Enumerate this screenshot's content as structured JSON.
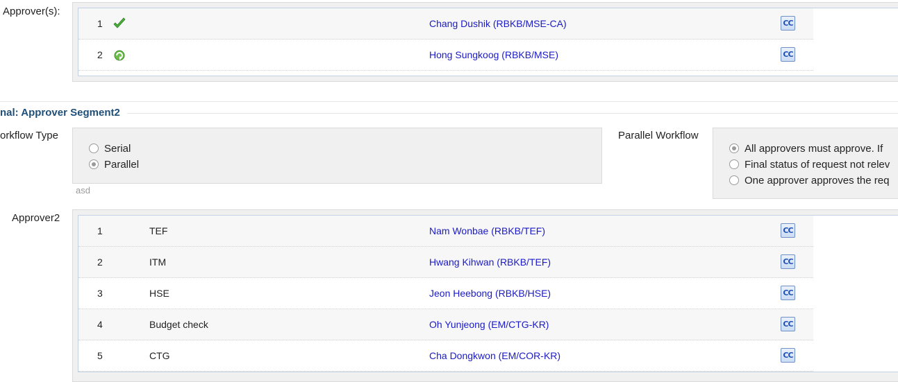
{
  "approvers_section": {
    "label": "Approver(s):",
    "rows": [
      {
        "num": "1",
        "status": "approved",
        "status_icon": "check-icon",
        "name": "Chang Dushik (RBKB/MSE-CA)",
        "cc": "CC"
      },
      {
        "num": "2",
        "status": "in-progress",
        "status_icon": "refresh-icon",
        "name": "Hong Sungkoog (RBKB/MSE)",
        "cc": "CC"
      }
    ]
  },
  "segment2": {
    "title": "nal: Approver Segment2",
    "workflow_type": {
      "label": "orkflow Type",
      "options": [
        {
          "label": "Serial",
          "checked": false
        },
        {
          "label": "Parallel",
          "checked": true
        }
      ],
      "hint": "asd"
    },
    "parallel_workflow": {
      "label": "Parallel Workflow",
      "options": [
        {
          "label": "All approvers must approve. If",
          "checked": true
        },
        {
          "label": "Final status of request not relev",
          "checked": false
        },
        {
          "label": "One approver approves the req",
          "checked": false
        }
      ]
    },
    "approver2": {
      "label": "Approver2",
      "rows": [
        {
          "num": "1",
          "desc": "TEF",
          "name": "Nam Wonbae (RBKB/TEF)",
          "cc": "CC"
        },
        {
          "num": "2",
          "desc": "ITM",
          "name": "Hwang Kihwan (RBKB/TEF)",
          "cc": "CC"
        },
        {
          "num": "3",
          "desc": "HSE",
          "name": "Jeon Heebong (RBKB/HSE)",
          "cc": "CC"
        },
        {
          "num": "4",
          "desc": "Budget check",
          "name": "Oh Yunjeong (EM/CTG-KR)",
          "cc": "CC"
        },
        {
          "num": "5",
          "desc": "CTG",
          "name": "Cha Dongkwon (EM/COR-KR)",
          "cc": "CC"
        }
      ]
    }
  },
  "colors": {
    "link": "#1a1ac8",
    "section_title": "#1f4f78",
    "check_green": "#4caf3a"
  }
}
